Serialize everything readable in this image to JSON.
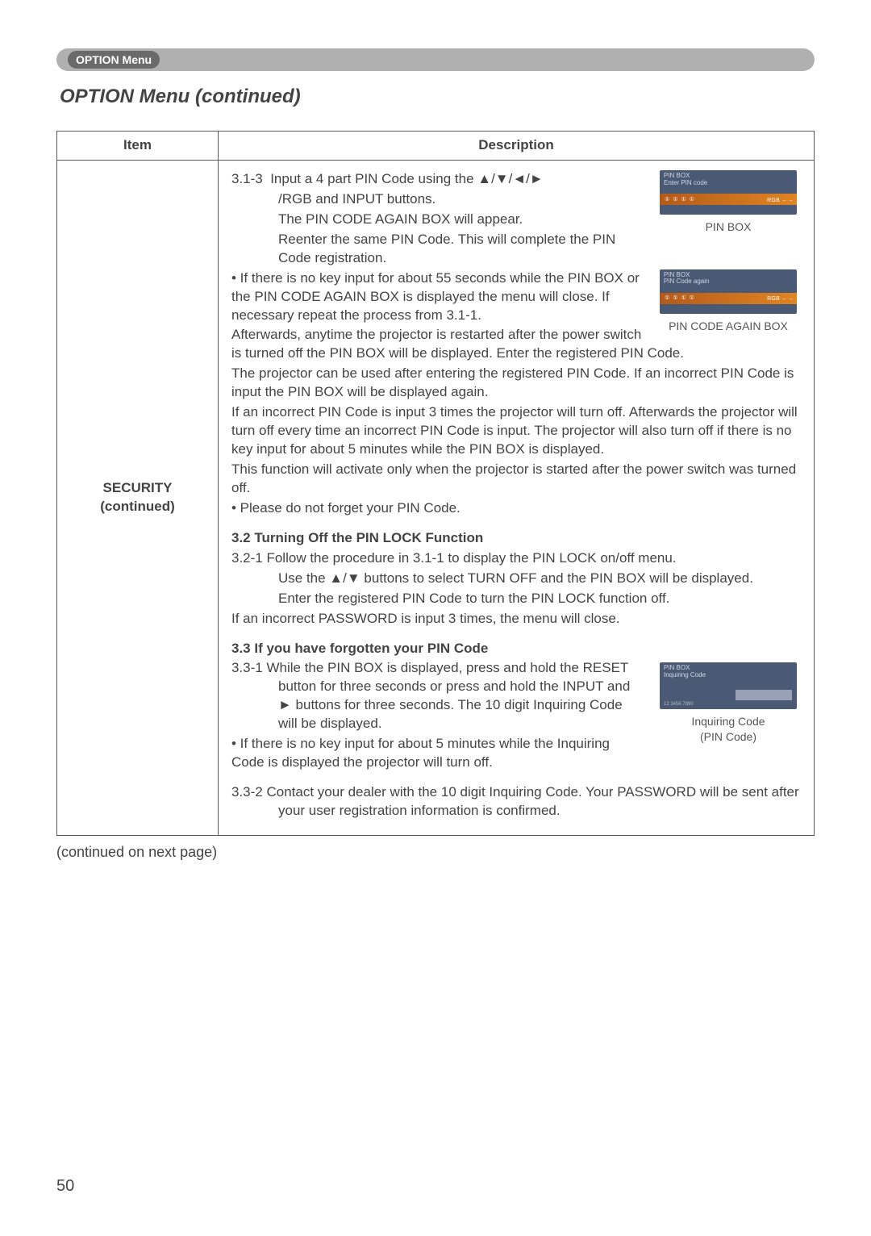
{
  "ribbon": {
    "label": "OPTION Menu"
  },
  "title": "OPTION Menu (continued)",
  "table": {
    "headers": {
      "item": "Item",
      "description": "Description"
    },
    "row": {
      "item_line1": "SECURITY",
      "item_line2": "(continued)",
      "desc": {
        "p313_a": "3.1-3  Input a 4 part PIN Code using the ▲/▼/◄/►",
        "p313_b": "/RGB and INPUT buttons.",
        "p313_c": "The PIN CODE AGAIN BOX will appear.",
        "p313_d": "Reenter the same PIN Code. This will complete the PIN Code registration.",
        "bullet1": "• If there is no key input for about 55 seconds while the PIN BOX or the PIN CODE AGAIN BOX is displayed the menu will close. If necessary repeat the process from 3.1-1.",
        "after1": "Afterwards, anytime the projector is restarted after the power switch is turned off the PIN BOX will be displayed. Enter the registered PIN Code.",
        "after2": "The projector can be used after entering the registered PIN Code. If an incorrect PIN Code is input the PIN BOX will be displayed again.",
        "after3": "If an incorrect PIN Code is input 3 times the projector will turn off. Afterwards the projector will turn off every time an incorrect PIN Code is input. The projector will also turn off if there is no key input for about 5 minutes while the PIN BOX is displayed.",
        "after4": "This function will activate only when the projector is started after the power switch was turned off.",
        "bullet2": "• Please do not forget your PIN Code.",
        "h32": "3.2 Turning Off the PIN LOCK Function",
        "p321_a": "3.2-1 Follow the procedure in 3.1-1 to display the PIN LOCK on/off menu.",
        "p321_b": "Use the ▲/▼ buttons to select TURN OFF and the PIN BOX will be displayed.",
        "p321_c": "Enter the registered PIN Code to turn the PIN LOCK function off.",
        "p32_after": "If an incorrect PASSWORD is input 3 times, the menu will close.",
        "h33": "3.3 If you have forgotten your PIN Code",
        "p331_a": "3.3-1 While the PIN BOX is displayed, press and hold the RESET button for three seconds or press and hold the INPUT and ► buttons for three seconds. The 10 digit Inquiring Code will be displayed.",
        "bullet3": "• If there is no key input for about 5 minutes while the Inquiring Code is displayed the projector will turn off.",
        "p332": "3.3-2 Contact your dealer with the 10 digit Inquiring Code. Your PASSWORD will be sent after your user registration information is confirmed.",
        "fig1_caption": "PIN BOX",
        "fig2_caption": "PIN CODE AGAIN BOX",
        "fig3_caption_l1": "Inquiring Code",
        "fig3_caption_l2": "(PIN Code)",
        "osd": {
          "pinbox_title": "PIN BOX",
          "pinbox_sub": "Enter PIN code",
          "again_title": "PIN BOX",
          "again_sub": "PIN Code again",
          "inquire_title": "PIN BOX",
          "inquire_sub": "Inquiring Code",
          "dots": "① ① ① ①",
          "band_suffix": "RGB ←→",
          "grey_text": "12 3456 7890"
        }
      }
    }
  },
  "continued": "(continued on next page)",
  "page_number": "50"
}
